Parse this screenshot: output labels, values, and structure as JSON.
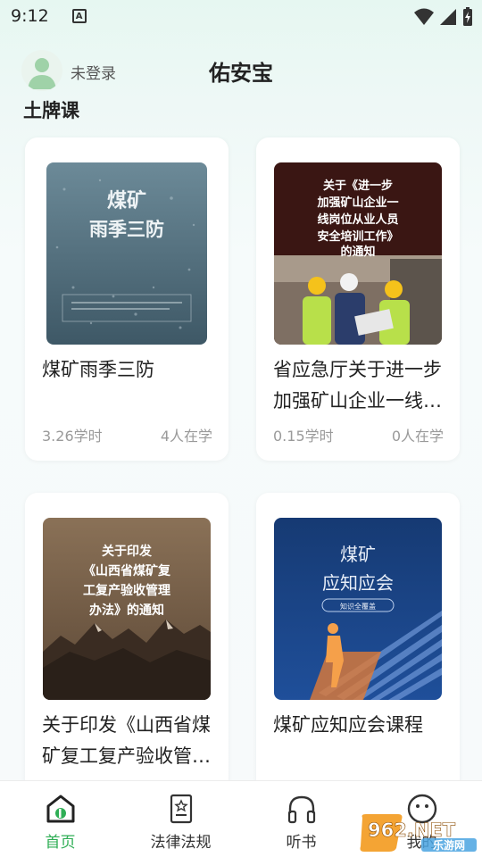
{
  "status_bar": {
    "time": "9:12",
    "indicator": "A"
  },
  "header": {
    "login_status": "未登录",
    "title": "佑安宝"
  },
  "section": {
    "title": "土牌课"
  },
  "courses": [
    {
      "title": "煤矿雨季三防",
      "hours": "3.26学时",
      "learners": "4人在学",
      "cover_text": [
        "煤矿",
        "雨季三防"
      ]
    },
    {
      "title": "省应急厅关于进一步加强矿山企业一线岗位从业人员安全培训工作的通知",
      "hours": "0.15学时",
      "learners": "0人在学",
      "cover_text": [
        "关于《进一步",
        "加强矿山企业一",
        "线岗位从业人员",
        "安全培训工作》",
        "的通知"
      ]
    },
    {
      "title": "关于印发《山西省煤矿复工复产验收管理办法》的通知",
      "cover_text": [
        "关于印发",
        "《山西省煤矿复",
        "工复产验收管理",
        "办法》的通知"
      ]
    },
    {
      "title": "煤矿应知应会课程",
      "cover_text": [
        "煤矿",
        "应知应会",
        "知识全覆盖"
      ]
    }
  ],
  "tabs": [
    {
      "label": "首页",
      "icon": "home-icon",
      "active": true
    },
    {
      "label": "法律法规",
      "icon": "document-icon",
      "active": false
    },
    {
      "label": "听书",
      "icon": "headphones-icon",
      "active": false
    },
    {
      "label": "我的",
      "icon": "profile-icon",
      "active": false
    }
  ],
  "watermark": {
    "text_top": "962.NET",
    "text_bottom": "乐游网"
  },
  "colors": {
    "accent": "#2fae55",
    "title_text": "#222222",
    "meta_text": "#9a9a9a"
  }
}
